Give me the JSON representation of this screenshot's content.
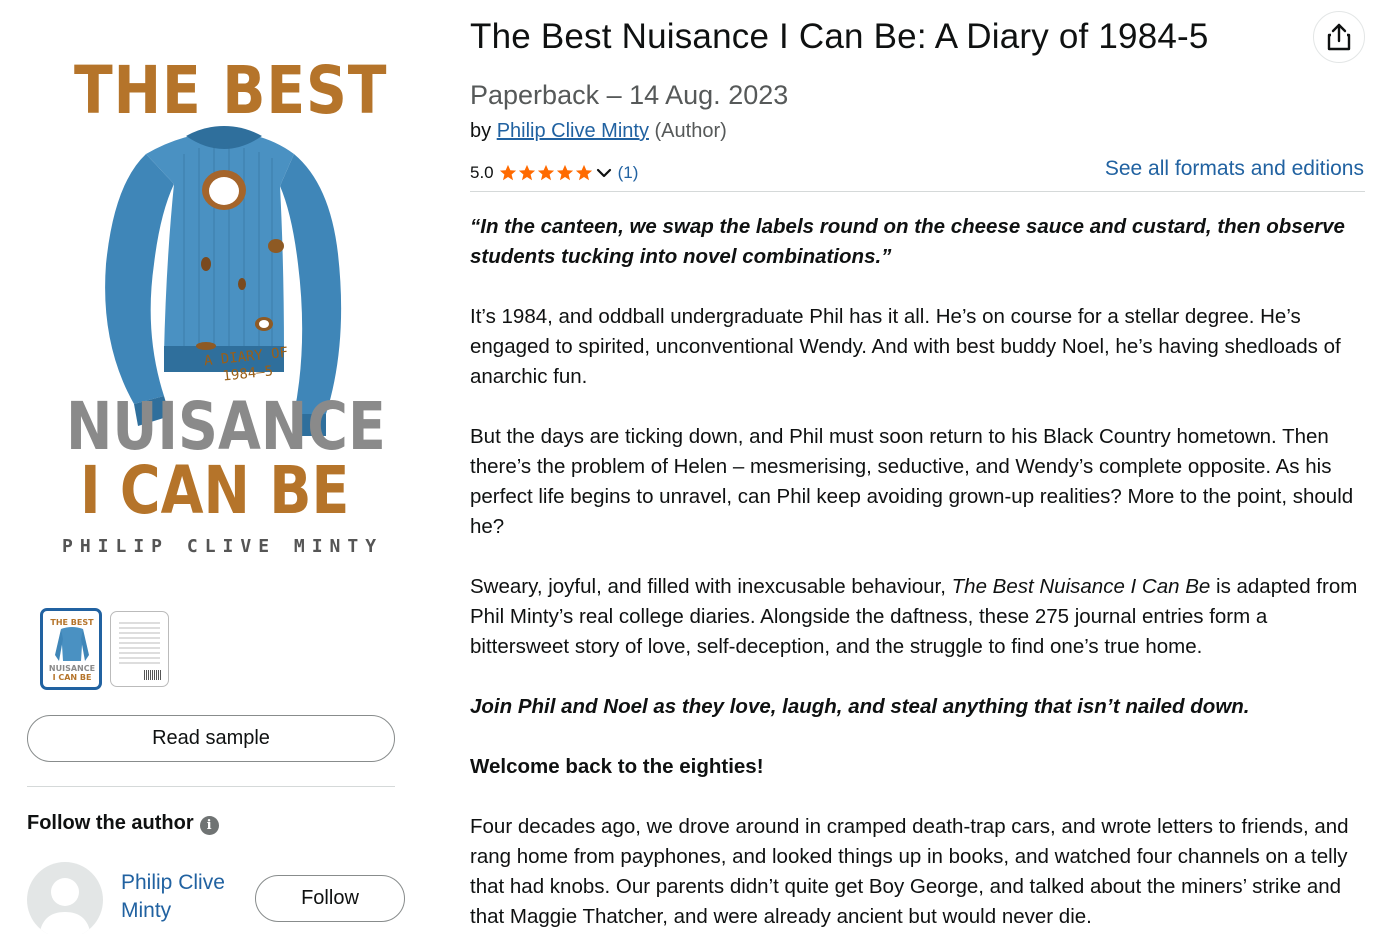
{
  "cover": {
    "title_top": "THE BEST",
    "subtitle": "A DIARY OF 1984–5",
    "title_mid": "NUISANCE",
    "title_bot": "I CAN BE",
    "author": "PHILIP CLIVE MINTY",
    "mini_top": "THE BEST",
    "mini_mid": "NUISANCE",
    "mini_bot": "I CAN BE"
  },
  "left": {
    "read_sample_label": "Read sample",
    "follow_heading": "Follow the author",
    "info_glyph": "i",
    "author_name": "Philip Clive Minty",
    "follow_label": "Follow"
  },
  "product": {
    "title": "The Best Nuisance I Can Be: A Diary of 1984-5",
    "format": "Paperback – 14 Aug. 2023",
    "by": "by",
    "author": "Philip Clive Minty",
    "author_role": "(Author)",
    "rating": "5.0",
    "stars": 5,
    "rating_count": "(1)",
    "formats_link": "See all formats and editions",
    "star_color": "#ff6a00"
  },
  "description": {
    "quote": "“In the canteen, we swap the labels round on the cheese sauce and custard, then observe students tucking into novel combinations.”",
    "p1": "It’s 1984, and oddball undergraduate Phil has it all. He’s on course for a stellar degree. He’s engaged to spirited, unconventional Wendy. And with best buddy Noel, he’s having shedloads of anarchic fun.",
    "p2": "But the days are ticking down, and Phil must soon return to his Black Country hometown. Then there’s the problem of Helen – mesmerising, seductive, and Wendy’s complete opposite. As his perfect life begins to unravel, can Phil keep avoiding grown-up realities? More to the point, should he?",
    "p3_pre": "Sweary, joyful, and filled with inexcusable behaviour, ",
    "p3_title": "The Best Nuisance I Can Be",
    "p3_post": " is adapted from Phil Minty’s real college diaries. Alongside the daftness, these 275 journal entries form a bittersweet story of love, self-deception, and the struggle to find one’s true home.",
    "p4": "Join Phil and Noel as they love, laugh, and steal anything that isn’t nailed down.",
    "p5": "Welcome back to the eighties!",
    "p6": "Four decades ago, we drove around in cramped death-trap cars, and wrote letters to friends, and rang home from payphones, and looked things up in books, and watched four channels on a telly that had knobs. Our parents didn’t quite get Boy George, and talked about the miners’ strike and that Maggie Thatcher, and were already ancient but would never die."
  },
  "colors": {
    "link": "#2162a1",
    "cover_orange": "#b5742a",
    "cover_grey": "#8a8a8a",
    "sweater_blue": "#3f86b8"
  }
}
